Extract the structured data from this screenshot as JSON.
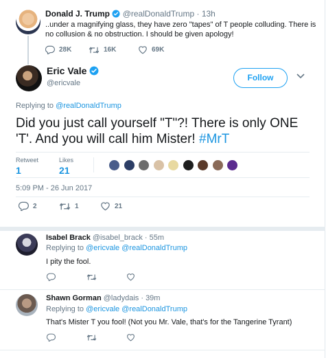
{
  "parent": {
    "name": "Donald J. Trump",
    "handle": "@realDonaldTrump",
    "time": "· 13h",
    "text": "..under a magnifying glass, they have zero \"tapes\" of T people colluding. There is no collusion & no obstruction. I should be given apology!",
    "replies": "28K",
    "retweets": "16K",
    "likes": "69K"
  },
  "main": {
    "name": "Eric Vale",
    "handle": "@ericvale",
    "follow_label": "Follow",
    "replying_prefix": "Replying to",
    "replying_to": "@realDonaldTrump",
    "text": "Did you just call yourself \"T\"?! There is only ONE 'T'. And you will call him Mister! ",
    "hashtag": "#MrT",
    "retweet_label": "Retweet",
    "retweet_count": "1",
    "likes_label": "Likes",
    "likes_count": "21",
    "timestamp": "5:09 PM - 26 Jun 2017",
    "action_replies": "2",
    "action_retweets": "1",
    "action_likes": "21"
  },
  "likers": [
    {
      "color": "#4a5d8a"
    },
    {
      "color": "#2c3e66"
    },
    {
      "color": "#6d6d6d"
    },
    {
      "color": "#d9c2a6"
    },
    {
      "color": "#e8d9a0"
    },
    {
      "color": "#1e1e1e"
    },
    {
      "color": "#5a3a2a"
    },
    {
      "color": "#8a6a58"
    },
    {
      "color": "#5b2b8f"
    }
  ],
  "replies": [
    {
      "name": "Isabel Brack",
      "handle": "@isabel_brack",
      "time": "· 55m",
      "replying_prefix": "Replying to",
      "mentions": "@ericvale @realDonaldTrump",
      "text": "I pity the fool."
    },
    {
      "name": "Shawn Gorman",
      "handle": "@ladydais",
      "time": "· 39m",
      "replying_prefix": "Replying to",
      "mentions": "@ericvale @realDonaldTrump",
      "text": "That's Mister T you fool! (Not you Mr. Vale, that's for the Tangerine Tyrant)"
    }
  ],
  "colors": {
    "accent": "#1da1f2",
    "link": "#1b95e0",
    "muted": "#657786",
    "divider": "#e6ecf0"
  },
  "icons": {
    "reply": "reply-icon",
    "retweet": "retweet-icon",
    "like": "heart-icon",
    "verified": "verified-badge-icon",
    "more": "chevron-down-icon"
  }
}
